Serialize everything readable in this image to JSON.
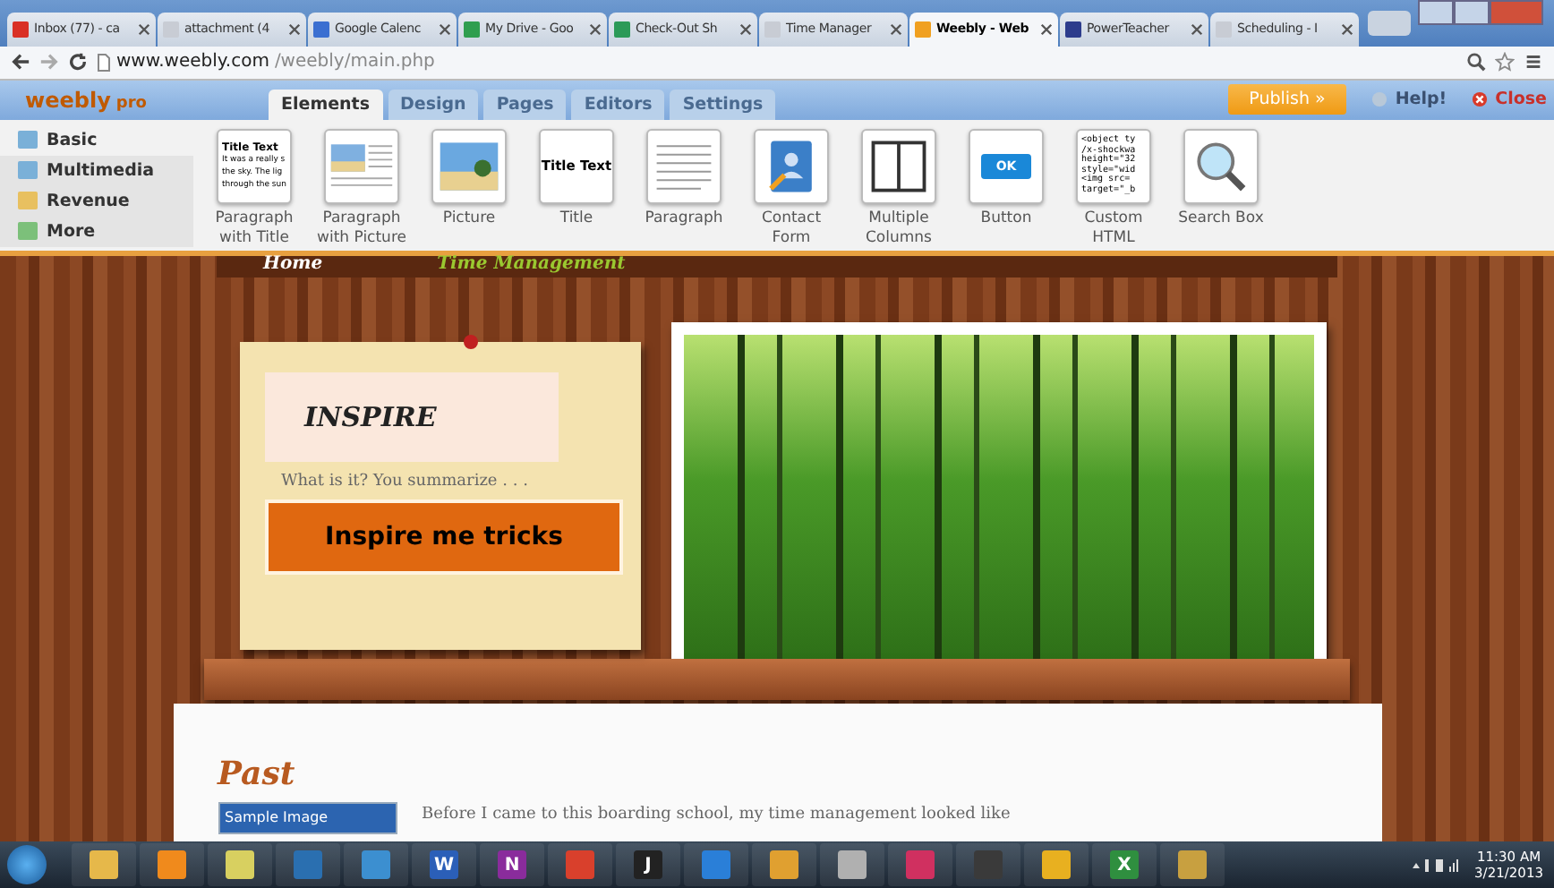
{
  "browser": {
    "tabs": [
      {
        "title": "Inbox (77) - ca",
        "color": "#d93025",
        "selected": false
      },
      {
        "title": "attachment (4",
        "color": "#c8ccd4",
        "selected": false
      },
      {
        "title": "Google Calenc",
        "color": "#3b6fd1",
        "selected": false
      },
      {
        "title": "My Drive - Goo",
        "color": "#2f9e4f",
        "selected": false
      },
      {
        "title": "Check-Out Sh",
        "color": "#2c9a58",
        "selected": false
      },
      {
        "title": "Time Manager",
        "color": "#c8ccd4",
        "selected": false
      },
      {
        "title": "Weebly - Web",
        "color": "#f0a020",
        "selected": true
      },
      {
        "title": "PowerTeacher",
        "color": "#2d3c8c",
        "selected": false
      },
      {
        "title": "Scheduling - I",
        "color": "#c8ccd4",
        "selected": false
      }
    ],
    "url_host": "www.weebly.com",
    "url_path": "/weebly/main.php"
  },
  "editor": {
    "logo": "weebly",
    "logo_badge": "pro",
    "tabs": [
      {
        "label": "Elements",
        "selected": true
      },
      {
        "label": "Design",
        "selected": false
      },
      {
        "label": "Pages",
        "selected": false
      },
      {
        "label": "Editors",
        "selected": false
      },
      {
        "label": "Settings",
        "selected": false
      }
    ],
    "publish": "Publish »",
    "help": "Help!",
    "close": "Close",
    "categories": [
      {
        "label": "Basic",
        "selected": true
      },
      {
        "label": "Multimedia",
        "selected": false
      },
      {
        "label": "Revenue",
        "selected": false
      },
      {
        "label": "More",
        "selected": false
      }
    ],
    "elements": [
      {
        "kind": "paragraph-title",
        "label": [
          "Paragraph",
          "with Title"
        ],
        "thumb_title": "Title Text",
        "thumb_lines": [
          "It was a really s",
          "the sky.  The lig",
          "through the sun"
        ]
      },
      {
        "kind": "paragraph-picture",
        "label": [
          "Paragraph",
          "with Picture"
        ]
      },
      {
        "kind": "picture",
        "label": [
          "Picture"
        ]
      },
      {
        "kind": "title",
        "label": [
          "Title"
        ],
        "thumb_title": "Title Text"
      },
      {
        "kind": "paragraph",
        "label": [
          "Paragraph"
        ]
      },
      {
        "kind": "contact",
        "label": [
          "Contact",
          "Form"
        ]
      },
      {
        "kind": "columns",
        "label": [
          "Multiple",
          "Columns"
        ]
      },
      {
        "kind": "button",
        "label": [
          "Button"
        ],
        "thumb_title": "OK"
      },
      {
        "kind": "html",
        "label": [
          "Custom",
          "HTML"
        ],
        "thumb_lines": [
          "<object ty",
          "/x-shockwa",
          "height=\"32",
          "style=\"wid",
          "<img src=",
          "target=\"_b"
        ]
      },
      {
        "kind": "search",
        "label": [
          "Search Box"
        ]
      }
    ]
  },
  "site": {
    "nav": [
      "Home",
      "Time Management"
    ],
    "note": {
      "heading": "INSPIRE",
      "text": "What is it? You summarize . . .",
      "button": "Inspire me tricks"
    },
    "section_title": "Past",
    "image_caption": "Sample Image",
    "paragraph": "Before I came to this boarding school, my time management looked like"
  },
  "taskbar": {
    "apps": [
      {
        "color": "#e6b84a"
      },
      {
        "color": "#f08a1c"
      },
      {
        "color": "#d8d060"
      },
      {
        "color": "#2a6fb0"
      },
      {
        "color": "#3c8fd0"
      },
      {
        "color": "#2b5fb8",
        "glyph": "W"
      },
      {
        "color": "#8a2c9c",
        "glyph": "N"
      },
      {
        "color": "#d9402c"
      },
      {
        "color": "#222222",
        "glyph": "J"
      },
      {
        "color": "#2a7fd8"
      },
      {
        "color": "#e0a030"
      },
      {
        "color": "#b0b0b0"
      },
      {
        "color": "#d03060"
      },
      {
        "color": "#3a3a3a"
      },
      {
        "color": "#e8b020"
      },
      {
        "color": "#2f8f3f",
        "glyph": "X"
      },
      {
        "color": "#c8a040"
      }
    ],
    "time": "11:30 AM",
    "date": "3/21/2013"
  }
}
